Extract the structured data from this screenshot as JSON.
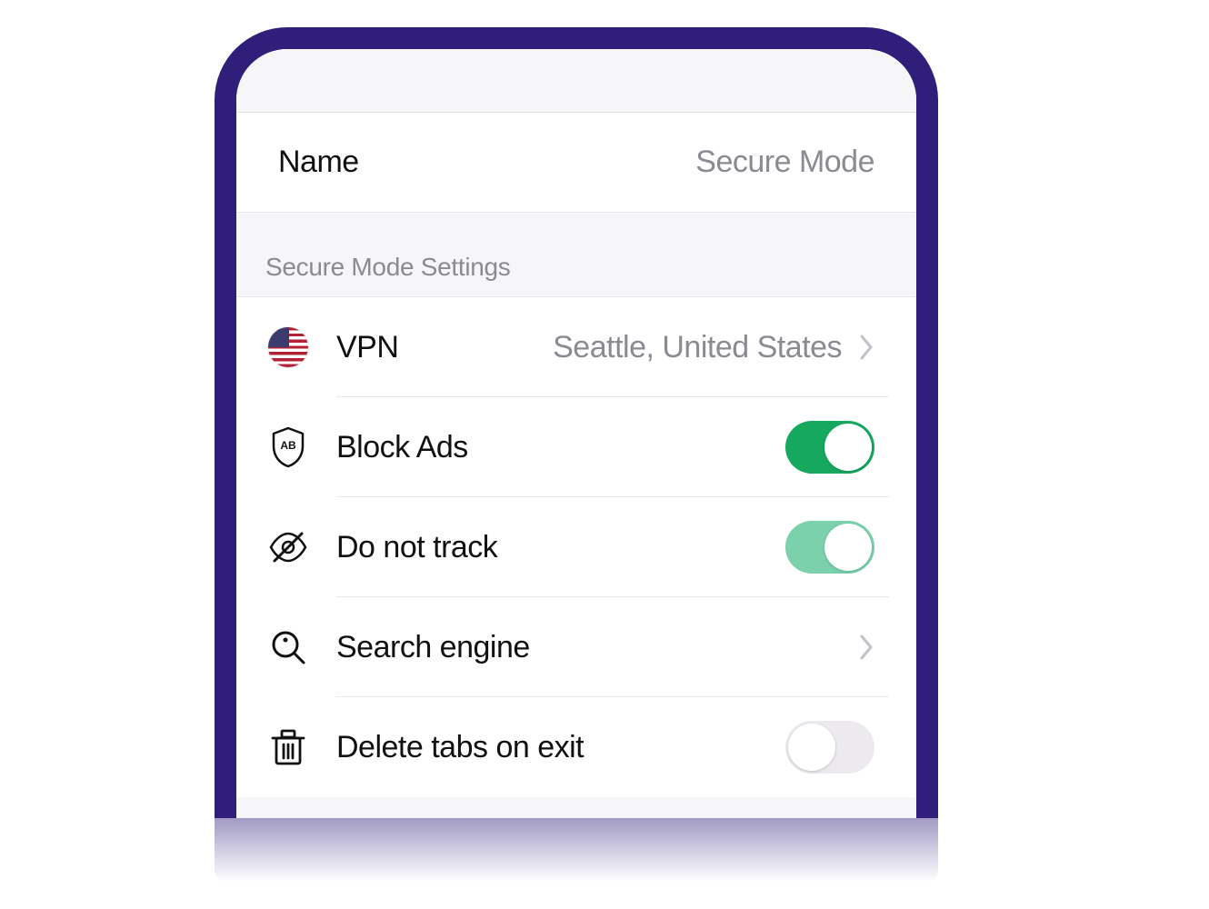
{
  "name_row": {
    "label": "Name",
    "value": "Secure Mode"
  },
  "section": {
    "title": "Secure Mode Settings"
  },
  "items": {
    "vpn": {
      "label": "VPN",
      "value": "Seattle, United States"
    },
    "block_ads": {
      "label": "Block Ads",
      "enabled": true
    },
    "do_not_track": {
      "label": "Do not track",
      "enabled": true
    },
    "search_engine": {
      "label": "Search engine"
    },
    "delete_tabs": {
      "label": "Delete tabs on exit",
      "enabled": false
    }
  }
}
